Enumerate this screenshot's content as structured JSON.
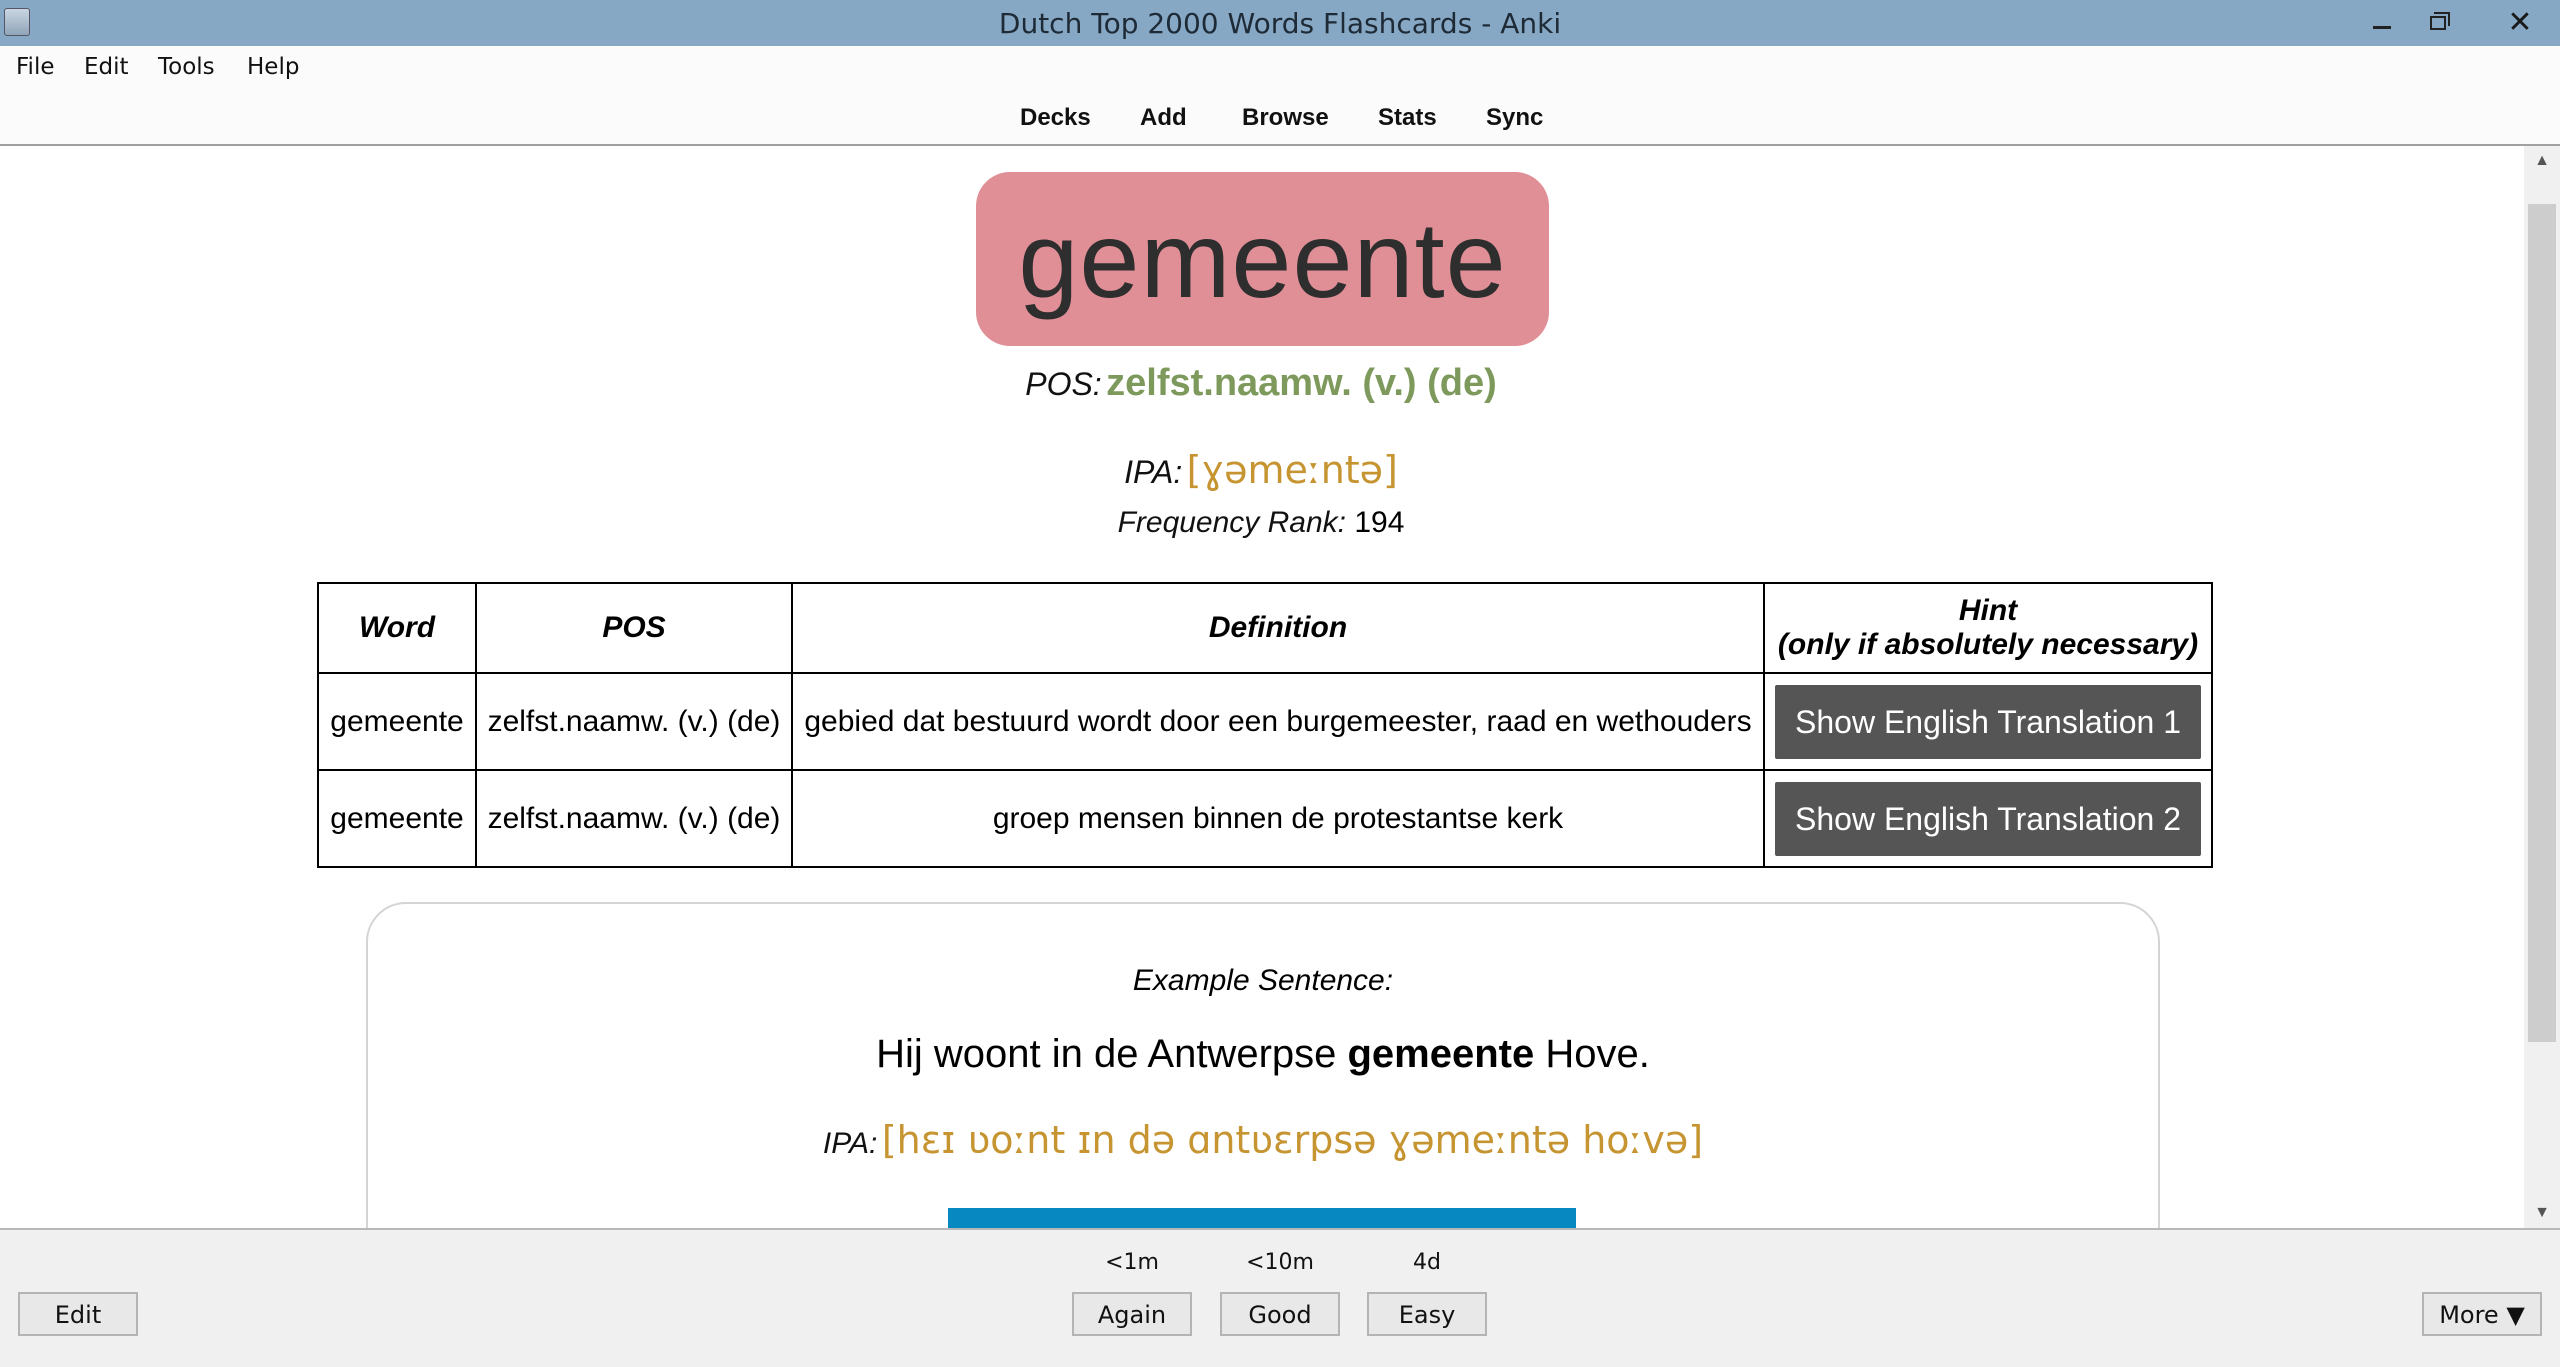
{
  "window": {
    "title": "Dutch Top 2000 Words Flashcards - Anki"
  },
  "menubar": {
    "items": [
      "File",
      "Edit",
      "Tools",
      "Help"
    ]
  },
  "toolbar": {
    "items": [
      "Decks",
      "Add",
      "Browse",
      "Stats",
      "Sync"
    ]
  },
  "card": {
    "word": "gemeente",
    "pos_label": "POS:",
    "pos_value": "zelfst.naamw. (v.) (de)",
    "ipa_label": "IPA:",
    "ipa_value": "[ɣəmeːntə]",
    "freq_label": "Frequency Rank:",
    "freq_value": "194",
    "colors": {
      "word_bg": "#e08f97",
      "pos": "#7d9a5c",
      "ipa": "#c69430",
      "audio": "#0788c0"
    }
  },
  "table": {
    "headers": {
      "word": "Word",
      "pos": "POS",
      "definition": "Definition",
      "hint_line1": "Hint",
      "hint_line2": "(only if absolutely necessary)"
    },
    "rows": [
      {
        "word": "gemeente",
        "pos": "zelfst.naamw. (v.) (de)",
        "definition": "gebied dat bestuurd wordt door een burgemeester, raad en wethouders",
        "hint": "Show English Translation 1"
      },
      {
        "word": "gemeente",
        "pos": "zelfst.naamw. (v.) (de)",
        "definition": "groep mensen binnen de protestantse kerk",
        "hint": "Show English Translation 2"
      }
    ]
  },
  "example": {
    "label": "Example Sentence:",
    "before": "Hij woont in de Antwerpse ",
    "bold": "gemeente",
    "after": " Hove.",
    "ipa_label": "IPA:",
    "ipa_value": "[hɛɪ ʋoːnt ɪn də ɑntʋɛrpsə ɣəmeːntə hoːvə]"
  },
  "bottom": {
    "edit": "Edit",
    "more": "More ▼",
    "answers": [
      {
        "interval": "<1m",
        "label": "Again"
      },
      {
        "interval": "<10m",
        "label": "Good"
      },
      {
        "interval": "4d",
        "label": "Easy"
      }
    ]
  }
}
